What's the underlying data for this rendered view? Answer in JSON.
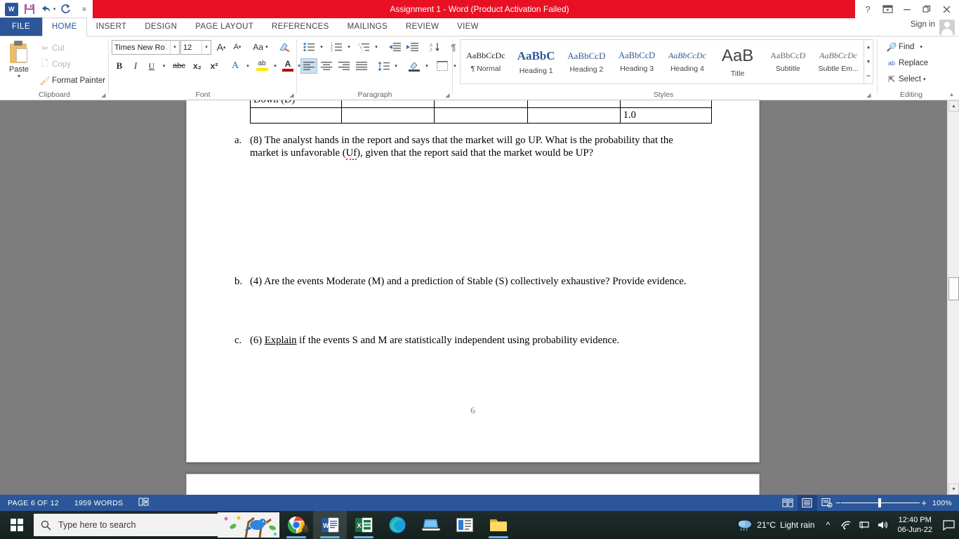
{
  "titlebar": {
    "title": "Assignment 1 -  Word (Product Activation Failed)",
    "accent_color": "#e81123",
    "quick_access": [
      {
        "name": "word-logo-icon",
        "label": "W"
      },
      {
        "name": "save-icon",
        "label": "ὋE"
      },
      {
        "name": "undo-icon",
        "label": "↶"
      },
      {
        "name": "redo-icon",
        "label": "↻"
      },
      {
        "name": "customize-qat-icon",
        "label": "☷"
      }
    ],
    "window_controls": [
      {
        "name": "help-button",
        "label": "?"
      },
      {
        "name": "ribbon-display-options-button",
        "label": "⬚"
      },
      {
        "name": "minimize-button",
        "label": "—"
      },
      {
        "name": "restore-button",
        "label": "❐"
      },
      {
        "name": "close-button",
        "label": "✕"
      }
    ]
  },
  "tabs": {
    "file": "FILE",
    "items": [
      "HOME",
      "INSERT",
      "DESIGN",
      "PAGE LAYOUT",
      "REFERENCES",
      "MAILINGS",
      "REVIEW",
      "VIEW"
    ],
    "active": "HOME",
    "sign_in": "Sign in"
  },
  "ribbon": {
    "clipboard": {
      "label": "Clipboard",
      "paste": "Paste",
      "cut": "Cut",
      "copy": "Copy",
      "format_painter": "Format Painter"
    },
    "font": {
      "label": "Font",
      "font_name": "Times New Ro",
      "font_size": "12",
      "grow_font": "A",
      "shrink_font": "A",
      "change_case": "Aa",
      "clear_formatting": "✐",
      "bold": "B",
      "italic": "I",
      "underline": "U",
      "strikethrough": "abc",
      "subscript": "x₂",
      "superscript": "x²",
      "text_effects": "A",
      "highlight": "ab",
      "font_color": "A"
    },
    "paragraph": {
      "label": "Paragraph",
      "bullets": "☰",
      "numbering": "②",
      "multilevel": "☷",
      "decrease_indent": "⇤",
      "increase_indent": "⇥",
      "sort": "A↓",
      "show_marks": "¶",
      "align_left": "≡",
      "align_center": "≡",
      "align_right": "≡",
      "justify": "≡",
      "line_spacing": "↕",
      "shading": "▣",
      "borders": "▦"
    },
    "styles": {
      "label": "Styles",
      "items": [
        {
          "preview": "AaBbCcDc",
          "name": "¶ Normal"
        },
        {
          "preview": "AaBbC",
          "name": "Heading 1"
        },
        {
          "preview": "AaBbCcD",
          "name": "Heading 2"
        },
        {
          "preview": "AaBbCcD",
          "name": "Heading 3"
        },
        {
          "preview": "AaBbCcDc",
          "name": "Heading 4"
        },
        {
          "preview": "AaB",
          "name": "Title"
        },
        {
          "preview": "AaBbCcD",
          "name": "Subtitle"
        },
        {
          "preview": "AaBbCcDc",
          "name": "Subtle Em..."
        }
      ]
    },
    "editing": {
      "label": "Editing",
      "find": "Find",
      "replace": "Replace",
      "select": "Select"
    }
  },
  "document": {
    "table_partial": {
      "clipped_row_label": "Down (D)",
      "rows": [
        [
          "",
          "",
          "",
          "",
          "1.0"
        ]
      ]
    },
    "questions": [
      {
        "label": "a.",
        "text_before": "(8) The analyst hands in the report and says that the market will go UP. What is the probability that the market is unfavorable (",
        "misspelled": "Uf",
        "text_after": "), given that the report said that the market would be UP?"
      },
      {
        "label": "b.",
        "text": "(4) Are the events Moderate (M) and a prediction of Stable (S) collectively exhaustive? Provide evidence."
      },
      {
        "label": "c.",
        "text_before": "(6) ",
        "underlined": "Explain",
        "text_after": " if the events S and M are statistically independent using probability evidence."
      }
    ],
    "page_footer_number": "6"
  },
  "statusbar": {
    "page": "PAGE 6 OF 12",
    "words": "1959 WORDS",
    "proofing_icon": "proofing-errors-icon",
    "views": [
      {
        "name": "read-mode-view-button",
        "glyph": "▤"
      },
      {
        "name": "print-layout-view-button",
        "glyph": "▤"
      },
      {
        "name": "web-layout-view-button",
        "glyph": "▤"
      }
    ],
    "zoom_out": "−",
    "zoom_in": "+",
    "zoom_level": "100%"
  },
  "taskbar": {
    "search_placeholder": "Type here to search",
    "apps": [
      {
        "name": "taskbar-chrome",
        "label": "Chrome"
      },
      {
        "name": "taskbar-word",
        "label": "Word"
      },
      {
        "name": "taskbar-excel",
        "label": "Excel"
      },
      {
        "name": "taskbar-edge",
        "label": "Edge"
      },
      {
        "name": "taskbar-remote-desktop",
        "label": "Remote Desktop"
      },
      {
        "name": "taskbar-news",
        "label": "News"
      },
      {
        "name": "taskbar-file-explorer",
        "label": "File Explorer"
      }
    ],
    "weather": {
      "temp": "21°C",
      "condition": "Light rain"
    },
    "tray": [
      {
        "name": "show-hidden-icons-chevron",
        "glyph": "∧"
      },
      {
        "name": "wifi-icon",
        "glyph": "◠"
      },
      {
        "name": "onedrive-icon",
        "glyph": "☁"
      },
      {
        "name": "volume-icon",
        "glyph": "◁"
      }
    ],
    "clock": {
      "time": "12:40 PM",
      "date": "06-Jun-22"
    },
    "action_center": "notification-icon"
  }
}
